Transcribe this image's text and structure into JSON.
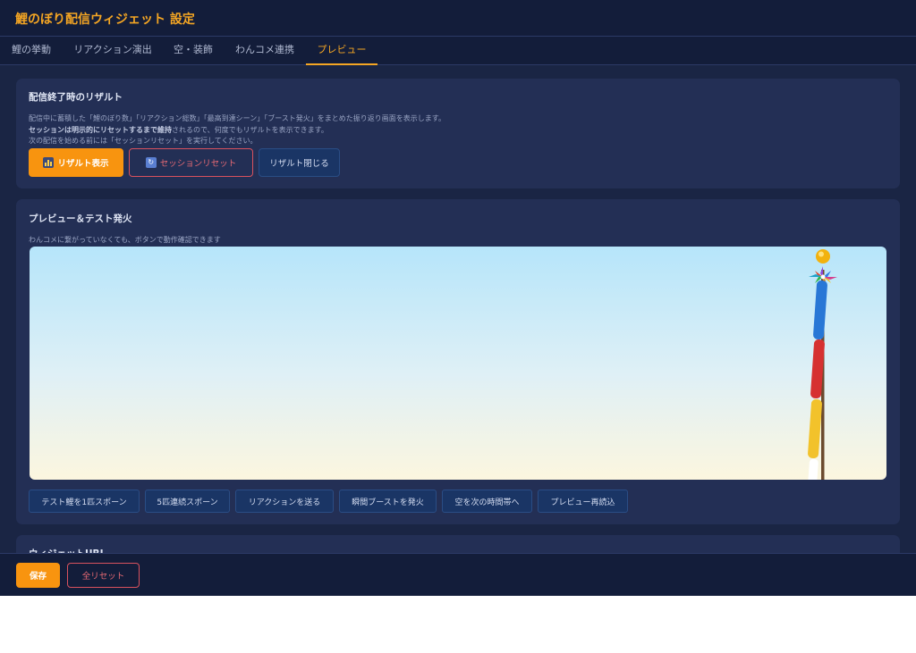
{
  "header": {
    "title": "鯉のぼり配信ウィジェット 設定"
  },
  "tabs": [
    {
      "label": "鯉の挙動"
    },
    {
      "label": "リアクション演出"
    },
    {
      "label": "空・装飾"
    },
    {
      "label": "わんコメ連携"
    },
    {
      "label": "プレビュー"
    }
  ],
  "active_tab": "プレビュー",
  "result": {
    "title": "配信終了時のリザルト",
    "desc_line1": "配信中に蓄積した「鯉のぼり数」「リアクション総数」「最高到達シーン」「ブースト発火」をまとめた振り返り画面を表示します。",
    "desc_line2_bold": "セッションは明示的にリセットするまで維持",
    "desc_line2_rest": "されるので、何度でもリザルトを表示できます。",
    "desc_line3": "次の配信を始める前には「セッションリセット」を実行してください。",
    "show_button": "リザルト表示",
    "reset_button": "セッションリセット",
    "close_button": "リザルト閉じる"
  },
  "preview": {
    "title": "プレビュー＆テスト発火",
    "desc": "わんコメに繋がっていなくても、ボタンで動作確認できます",
    "buttons": [
      "テスト鯉を1匹スポーン",
      "5匹連続スポーン",
      "リアクションを送る",
      "瞬間ブーストを発火",
      "空を次の時間帯へ",
      "プレビュー再読込"
    ]
  },
  "widget_url": {
    "title": "ウィジェットURL"
  },
  "footer": {
    "save": "保存",
    "reset_all": "全リセット"
  },
  "colors": {
    "accent": "#f8940f",
    "danger": "#d9525e",
    "background": "#1a2544",
    "panel": "#232f55"
  },
  "icons": {
    "result": "bar-chart-icon",
    "session_reset": "refresh-icon"
  }
}
